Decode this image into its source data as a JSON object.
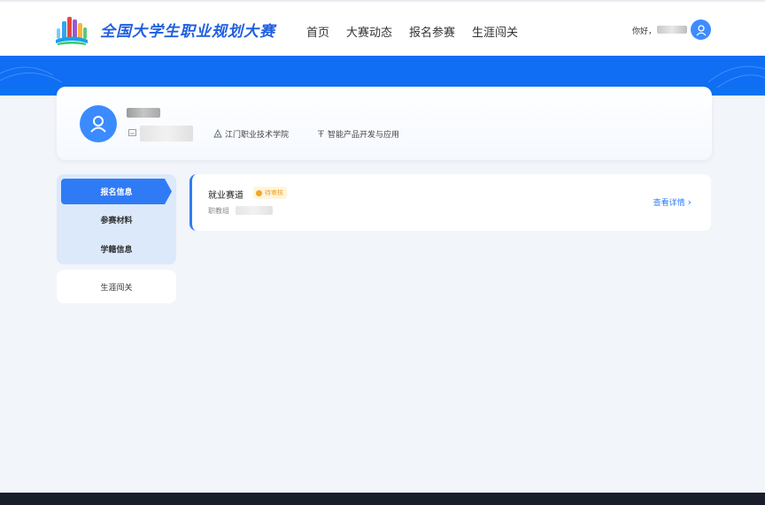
{
  "header": {
    "site_title": "全国大学生职业规划大赛",
    "nav": [
      "首页",
      "大赛动态",
      "报名参赛",
      "生涯闯关"
    ],
    "greeting": "你好，"
  },
  "profile": {
    "school": "江门职业技术学院",
    "major": "智能产品开发与应用"
  },
  "side_menu": {
    "items": [
      "报名信息",
      "参赛材料",
      "学籍信息"
    ],
    "active_index": 0,
    "extra": "生涯闯关"
  },
  "track": {
    "title": "就业赛道",
    "status": "待审核",
    "group_label": "职教组",
    "detail_link": "查看详情",
    "detail_chevron": "›"
  },
  "colors": {
    "primary": "#2f7bf6",
    "banner": "#0f6ef3",
    "status_bg": "#fff4dd",
    "status_text": "#f0a020",
    "footer": "#181f2b"
  }
}
